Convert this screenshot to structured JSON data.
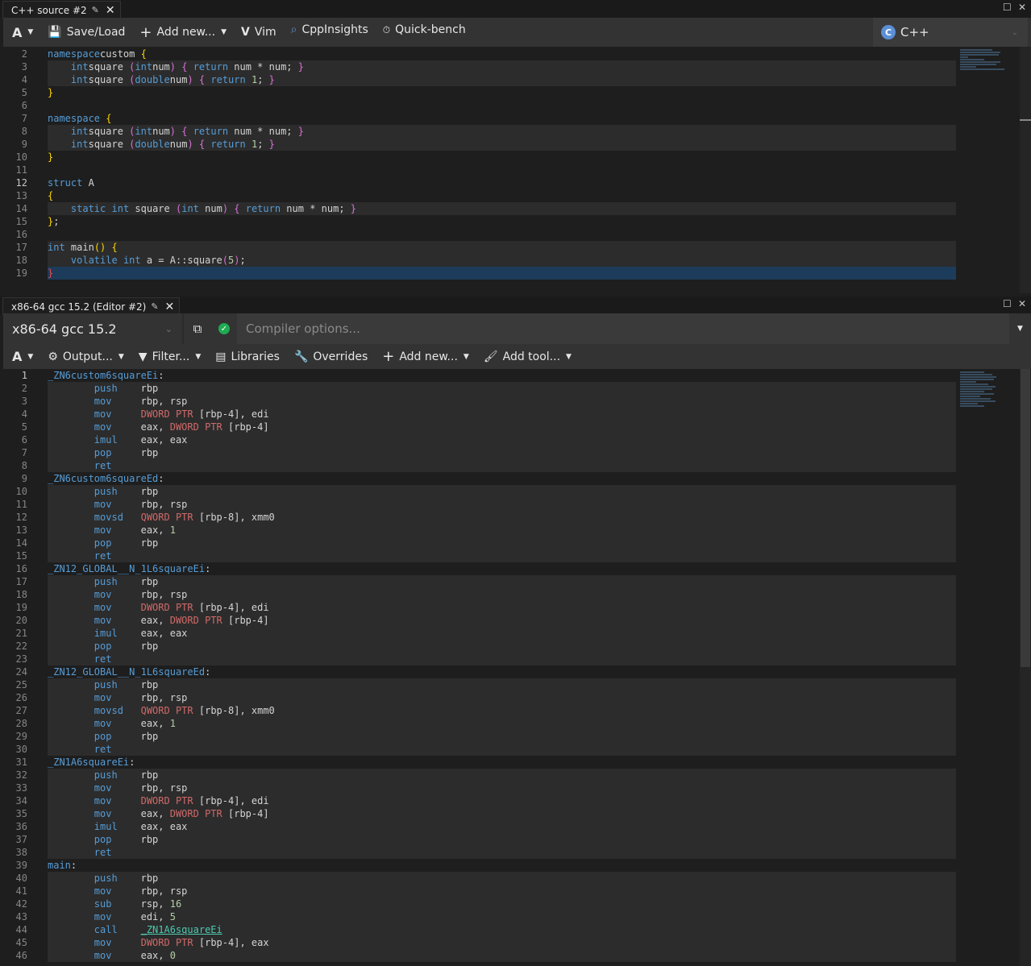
{
  "source_pane": {
    "tab_title": "C++ source #2",
    "toolbar": {
      "font_button": "A",
      "save_load": "Save/Load",
      "add_new": "Add new...",
      "vim": "Vim",
      "cppinsights": "CppInsights",
      "quickbench": "Quick-bench",
      "language": "C++",
      "language_icon": "C"
    },
    "first_line": 2,
    "active_line": 12,
    "current_line": 19
  },
  "compiler_pane": {
    "tab_title": "x86-64 gcc 15.2 (Editor #2)",
    "compiler_name": "x86-64 gcc 15.2",
    "compiler_options_placeholder": "Compiler options...",
    "toolbar": {
      "font_button": "A",
      "output": "Output...",
      "filter": "Filter...",
      "libraries": "Libraries",
      "overrides": "Overrides",
      "add_new": "Add new...",
      "add_tool": "Add tool..."
    },
    "first_line": 1,
    "active_line": 1
  },
  "icons": {
    "pencil": "pencil-icon",
    "close": "close-icon",
    "maximize": "maximize-icon",
    "save": "floppy-icon",
    "plus": "plus-icon",
    "vim": "vim-icon",
    "search": "search-icon",
    "stopwatch": "stopwatch-icon",
    "gear": "gear-icon",
    "filter": "filter-icon",
    "book": "book-icon",
    "wrench": "wrench-icon",
    "popout": "external-link-icon",
    "status": "check-circle-icon"
  },
  "colors": {
    "keyword": "#569cd6",
    "pointer": "#d16969",
    "number": "#b5cea8",
    "symbol": "#4ec9b0",
    "status_ok": "#1eab52",
    "selection": "#1d3b5a"
  },
  "source_lines": [
    [
      [
        "kw",
        "namespace"
      ],
      [
        "",
        "custom "
      ],
      [
        "b1",
        "{"
      ]
    ],
    [
      [
        "",
        "    "
      ],
      [
        "kw",
        "int"
      ],
      [
        "",
        "square "
      ],
      [
        "b2",
        "("
      ],
      [
        "kw",
        "int"
      ],
      [
        "",
        "num"
      ],
      [
        "b2",
        ")"
      ],
      [
        "",
        ""
      ],
      [
        "b2",
        " {"
      ],
      [
        "",
        ""
      ],
      [
        "kw",
        " return"
      ],
      [
        "",
        " num * num; "
      ],
      [
        "b2",
        "}"
      ]
    ],
    [
      [
        "",
        "    "
      ],
      [
        "kw",
        "int"
      ],
      [
        "",
        "square "
      ],
      [
        "b2",
        "("
      ],
      [
        "kw",
        "double"
      ],
      [
        "",
        "num"
      ],
      [
        "b2",
        ")"
      ],
      [
        "b2",
        " {"
      ],
      [
        "kw",
        " return"
      ],
      [
        "",
        " "
      ],
      [
        "num",
        "1"
      ],
      [
        "",
        "; "
      ],
      [
        "b2",
        "}"
      ]
    ],
    [
      [
        "b1",
        "}"
      ]
    ],
    [
      [
        "",
        ""
      ]
    ],
    [
      [
        "kw",
        "namespace"
      ],
      [
        "b1",
        " {"
      ]
    ],
    [
      [
        "",
        "    "
      ],
      [
        "kw",
        "int"
      ],
      [
        "",
        "square "
      ],
      [
        "b2",
        "("
      ],
      [
        "kw",
        "int"
      ],
      [
        "",
        "num"
      ],
      [
        "b2",
        ")"
      ],
      [
        "b2",
        " {"
      ],
      [
        "kw",
        " return"
      ],
      [
        "",
        " num * num; "
      ],
      [
        "b2",
        "}"
      ]
    ],
    [
      [
        "",
        "    "
      ],
      [
        "kw",
        "int"
      ],
      [
        "",
        "square "
      ],
      [
        "b2",
        "("
      ],
      [
        "kw",
        "double"
      ],
      [
        "",
        "num"
      ],
      [
        "b2",
        ")"
      ],
      [
        "b2",
        " {"
      ],
      [
        "kw",
        " return"
      ],
      [
        "",
        " "
      ],
      [
        "num",
        "1"
      ],
      [
        "",
        "; "
      ],
      [
        "b2",
        "}"
      ]
    ],
    [
      [
        "b1",
        "}"
      ]
    ],
    [
      [
        "",
        ""
      ]
    ],
    [
      [
        "kw",
        "struct"
      ],
      [
        "",
        " A"
      ]
    ],
    [
      [
        "b1",
        "{"
      ]
    ],
    [
      [
        "",
        "    "
      ],
      [
        "kw",
        "static"
      ],
      [
        "",
        " "
      ],
      [
        "kw",
        "int"
      ],
      [
        "",
        " square "
      ],
      [
        "b2",
        "("
      ],
      [
        "kw",
        "int"
      ],
      [
        "",
        " num"
      ],
      [
        "b2",
        ")"
      ],
      [
        "b2",
        " {"
      ],
      [
        "kw",
        " return"
      ],
      [
        "",
        " num * num; "
      ],
      [
        "b2",
        "}"
      ]
    ],
    [
      [
        "b1",
        "}"
      ],
      [
        "",
        ";"
      ]
    ],
    [
      [
        "",
        ""
      ]
    ],
    [
      [
        "kw",
        "int"
      ],
      [
        "",
        " main"
      ],
      [
        "b1",
        "()"
      ],
      [
        "b1",
        " {"
      ]
    ],
    [
      [
        "",
        "    "
      ],
      [
        "kw",
        "volatile"
      ],
      [
        "",
        " "
      ],
      [
        "kw",
        "int"
      ],
      [
        "",
        " a = A::square"
      ],
      [
        "b2",
        "("
      ],
      [
        "num",
        "5"
      ],
      [
        "b2",
        ")"
      ],
      [
        "",
        ";"
      ]
    ],
    [
      [
        "err",
        "}"
      ]
    ]
  ],
  "asm_lines": [
    [
      [
        "lbl",
        "_ZN6custom6squareEi"
      ],
      [
        "",
        ":"
      ]
    ],
    [
      [
        "ins",
        "        push"
      ],
      [
        "",
        "    rbp"
      ]
    ],
    [
      [
        "ins",
        "        mov"
      ],
      [
        "",
        "     rbp, rsp"
      ]
    ],
    [
      [
        "ins",
        "        mov"
      ],
      [
        "",
        "     "
      ],
      [
        "ptr",
        "DWORD PTR"
      ],
      [
        "",
        " [rbp-4], edi"
      ]
    ],
    [
      [
        "ins",
        "        mov"
      ],
      [
        "",
        "     eax, "
      ],
      [
        "ptr",
        "DWORD PTR"
      ],
      [
        "",
        " [rbp-4]"
      ]
    ],
    [
      [
        "ins",
        "        imul"
      ],
      [
        "",
        "    eax, eax"
      ]
    ],
    [
      [
        "ins",
        "        pop"
      ],
      [
        "",
        "     rbp"
      ]
    ],
    [
      [
        "ins",
        "        ret"
      ]
    ],
    [
      [
        "lbl",
        "_ZN6custom6squareEd"
      ],
      [
        "",
        ":"
      ]
    ],
    [
      [
        "ins",
        "        push"
      ],
      [
        "",
        "    rbp"
      ]
    ],
    [
      [
        "ins",
        "        mov"
      ],
      [
        "",
        "     rbp, rsp"
      ]
    ],
    [
      [
        "ins",
        "        movsd"
      ],
      [
        "",
        "   "
      ],
      [
        "ptr",
        "QWORD PTR"
      ],
      [
        "",
        " [rbp-8], xmm0"
      ]
    ],
    [
      [
        "ins",
        "        mov"
      ],
      [
        "",
        "     eax, "
      ],
      [
        "num",
        "1"
      ]
    ],
    [
      [
        "ins",
        "        pop"
      ],
      [
        "",
        "     rbp"
      ]
    ],
    [
      [
        "ins",
        "        ret"
      ]
    ],
    [
      [
        "lbl",
        "_ZN12_GLOBAL__N_1L6squareEi"
      ],
      [
        "",
        ":"
      ]
    ],
    [
      [
        "ins",
        "        push"
      ],
      [
        "",
        "    rbp"
      ]
    ],
    [
      [
        "ins",
        "        mov"
      ],
      [
        "",
        "     rbp, rsp"
      ]
    ],
    [
      [
        "ins",
        "        mov"
      ],
      [
        "",
        "     "
      ],
      [
        "ptr",
        "DWORD PTR"
      ],
      [
        "",
        " [rbp-4], edi"
      ]
    ],
    [
      [
        "ins",
        "        mov"
      ],
      [
        "",
        "     eax, "
      ],
      [
        "ptr",
        "DWORD PTR"
      ],
      [
        "",
        " [rbp-4]"
      ]
    ],
    [
      [
        "ins",
        "        imul"
      ],
      [
        "",
        "    eax, eax"
      ]
    ],
    [
      [
        "ins",
        "        pop"
      ],
      [
        "",
        "     rbp"
      ]
    ],
    [
      [
        "ins",
        "        ret"
      ]
    ],
    [
      [
        "lbl",
        "_ZN12_GLOBAL__N_1L6squareEd"
      ],
      [
        "",
        ":"
      ]
    ],
    [
      [
        "ins",
        "        push"
      ],
      [
        "",
        "    rbp"
      ]
    ],
    [
      [
        "ins",
        "        mov"
      ],
      [
        "",
        "     rbp, rsp"
      ]
    ],
    [
      [
        "ins",
        "        movsd"
      ],
      [
        "",
        "   "
      ],
      [
        "ptr",
        "QWORD PTR"
      ],
      [
        "",
        " [rbp-8], xmm0"
      ]
    ],
    [
      [
        "ins",
        "        mov"
      ],
      [
        "",
        "     eax, "
      ],
      [
        "num",
        "1"
      ]
    ],
    [
      [
        "ins",
        "        pop"
      ],
      [
        "",
        "     rbp"
      ]
    ],
    [
      [
        "ins",
        "        ret"
      ]
    ],
    [
      [
        "lbl",
        "_ZN1A6squareEi"
      ],
      [
        "",
        ":"
      ]
    ],
    [
      [
        "ins",
        "        push"
      ],
      [
        "",
        "    rbp"
      ]
    ],
    [
      [
        "ins",
        "        mov"
      ],
      [
        "",
        "     rbp, rsp"
      ]
    ],
    [
      [
        "ins",
        "        mov"
      ],
      [
        "",
        "     "
      ],
      [
        "ptr",
        "DWORD PTR"
      ],
      [
        "",
        " [rbp-4], edi"
      ]
    ],
    [
      [
        "ins",
        "        mov"
      ],
      [
        "",
        "     eax, "
      ],
      [
        "ptr",
        "DWORD PTR"
      ],
      [
        "",
        " [rbp-4]"
      ]
    ],
    [
      [
        "ins",
        "        imul"
      ],
      [
        "",
        "    eax, eax"
      ]
    ],
    [
      [
        "ins",
        "        pop"
      ],
      [
        "",
        "     rbp"
      ]
    ],
    [
      [
        "ins",
        "        ret"
      ]
    ],
    [
      [
        "lbl",
        "main"
      ],
      [
        "",
        ":"
      ]
    ],
    [
      [
        "ins",
        "        push"
      ],
      [
        "",
        "    rbp"
      ]
    ],
    [
      [
        "ins",
        "        mov"
      ],
      [
        "",
        "     rbp, rsp"
      ]
    ],
    [
      [
        "ins",
        "        sub"
      ],
      [
        "",
        "     rsp, "
      ],
      [
        "num",
        "16"
      ]
    ],
    [
      [
        "ins",
        "        mov"
      ],
      [
        "",
        "     edi, "
      ],
      [
        "num",
        "5"
      ]
    ],
    [
      [
        "ins",
        "        call"
      ],
      [
        "",
        "    "
      ],
      [
        "sym",
        "_ZN1A6squareEi"
      ]
    ],
    [
      [
        "ins",
        "        mov"
      ],
      [
        "",
        "     "
      ],
      [
        "ptr",
        "DWORD PTR"
      ],
      [
        "",
        " [rbp-4], eax"
      ]
    ],
    [
      [
        "ins",
        "        mov"
      ],
      [
        "",
        "     eax, "
      ],
      [
        "num",
        "0"
      ]
    ]
  ]
}
